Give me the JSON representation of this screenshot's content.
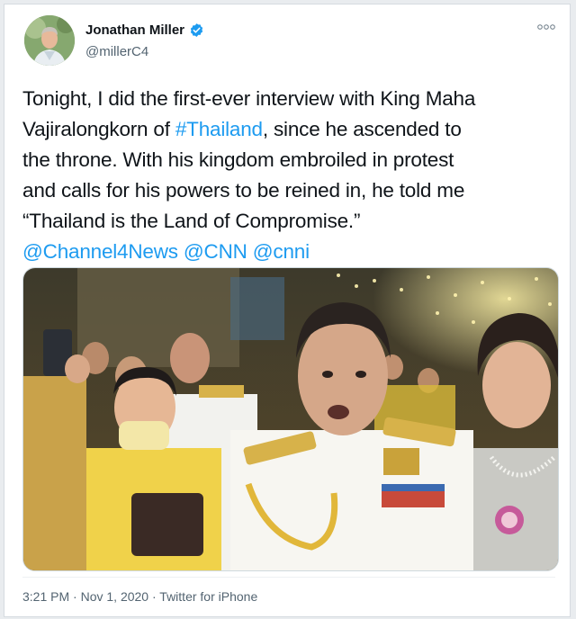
{
  "user": {
    "name": "Jonathan Miller",
    "handle": "@millerC4",
    "verified": true,
    "avatar_icon": "avatar"
  },
  "more_icon": "more-options-icon",
  "tweet": {
    "line1": "Tonight, I did the first-ever interview with King Maha",
    "line2_a": "Vajiralongkorn of ",
    "line2_hashtag": "#Thailand",
    "line2_b": ", since he ascended to",
    "line3": "the throne. With his kingdom embroiled in protest",
    "line4": "and calls for his powers to be reined in, he told me",
    "line5": "“Thailand is the Land of Compromise.”",
    "mentions": [
      "@Channel4News",
      "@CNN",
      "@cnni"
    ]
  },
  "media": {
    "type": "photo"
  },
  "meta": {
    "time": "3:21 PM",
    "date": "Nov 1, 2020",
    "source": "Twitter for iPhone",
    "separator": " · "
  },
  "colors": {
    "link": "#1d9bf0",
    "verified": "#1d9bf0",
    "text": "#0f1419",
    "secondary": "#536471"
  }
}
